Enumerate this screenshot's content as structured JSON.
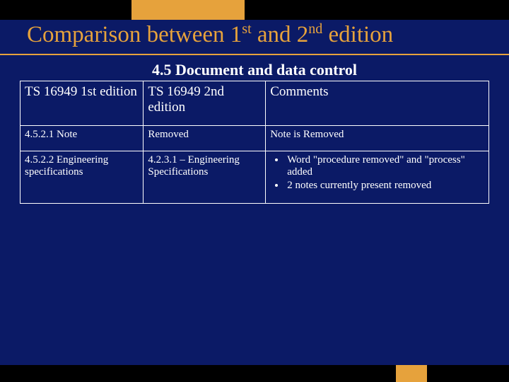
{
  "slide": {
    "title_parts": {
      "p1": "Comparison between 1",
      "sup1": "st",
      "p2": " and 2",
      "sup2": "nd",
      "p3": " edition"
    },
    "subtitle": "4.5 Document and data control"
  },
  "table": {
    "headers": {
      "col1": "TS 16949 1st edition",
      "col2": "TS 16949  2nd edition",
      "col3": "Comments"
    },
    "rows": [
      {
        "col1": "4.5.2.1 Note",
        "col2": "Removed",
        "col3_text": "Note is Removed",
        "col3_bullets": []
      },
      {
        "col1": "4.5.2.2 Engineering specifications",
        "col2": "4.2.3.1 – Engineering Specifications",
        "col3_text": "",
        "col3_bullets": [
          "Word \"procedure removed\" and \"process\" added",
          "2 notes currently present removed"
        ]
      }
    ]
  },
  "colors": {
    "background": "#0b1a66",
    "accent": "#e6a23c",
    "text": "#ffffff"
  }
}
